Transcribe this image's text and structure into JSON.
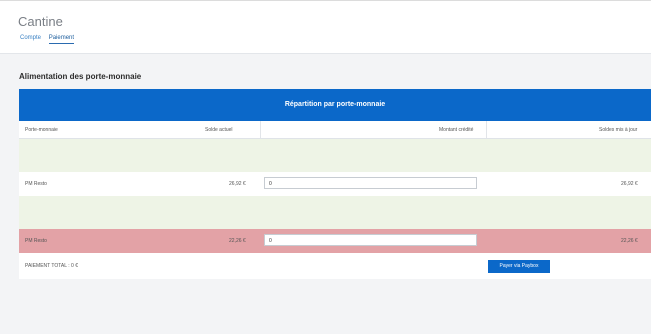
{
  "app": {
    "title": "Cantine"
  },
  "tabs": [
    {
      "label": "Compte",
      "active": false
    },
    {
      "label": "Paiement",
      "active": true
    }
  ],
  "section": {
    "title": "Alimentation des porte-monnaie"
  },
  "table": {
    "header": "Répartition par porte-monnaie",
    "columns": [
      "Porte-monnaie",
      "Solde actuel",
      "Montant crédité",
      "Soldes mis à jour"
    ],
    "rows": [
      {
        "wallet": "PM Resto",
        "balance": "26,92 €",
        "amount": "0",
        "new_balance": "26,92 €",
        "status": "normal"
      },
      {
        "wallet": "PM Resto",
        "balance": "22,26 €",
        "amount": "0",
        "new_balance": "22,26 €",
        "status": "alert"
      }
    ]
  },
  "footer": {
    "total": "PAIEMENT TOTAL : 0 €",
    "pay_button": "Payer via Paybox"
  },
  "colors": {
    "primary": "#0b68c9",
    "spacer": "#eef4e6",
    "alert_row": "#e3a2a6"
  }
}
